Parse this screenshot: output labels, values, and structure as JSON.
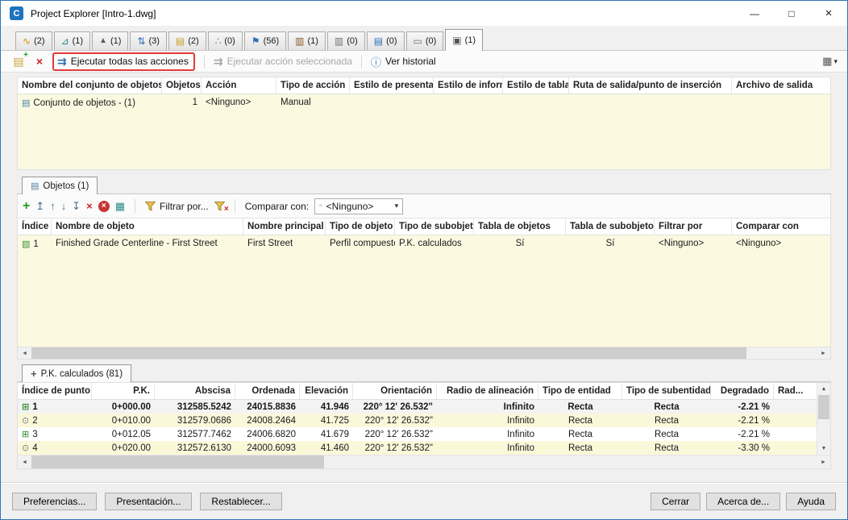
{
  "window": {
    "title": "Project Explorer [Intro-1.dwg]"
  },
  "icons": {
    "app_logo": "C",
    "minimize": "—",
    "maximize": "□",
    "close": "×",
    "tabs": [
      "∿",
      "⊿",
      "▲",
      "⇅",
      "▤",
      "∴",
      "⚑",
      "▥",
      "▥",
      "▤",
      "▭",
      "▣"
    ],
    "new_action_set": "▤",
    "new_action_plus": "+",
    "delete_action_set": "×",
    "run_all": "⇉",
    "run_selected": "⇉",
    "history_info": "ⓘ",
    "columns": "▦",
    "dropdown_arrow": "▾",
    "add": "+",
    "move_top": "↥",
    "move_up": "↑",
    "move_down": "↓",
    "move_bottom": "↧",
    "remove": "×",
    "remove_all": "×",
    "table_style": "▦",
    "clear_filter_x": "×",
    "none_box": "▫",
    "objects_tab_icon": "▤",
    "stations_tab_icon": "+",
    "set_row_icon": "▤",
    "object_row_icon": "▧",
    "station_major": "⊞",
    "station_minor": "⊙",
    "left": "◄",
    "right": "►",
    "up": "▲",
    "down": "▼"
  },
  "tabs": [
    {
      "count": "(2)"
    },
    {
      "count": "(1)"
    },
    {
      "count": "(1)"
    },
    {
      "count": "(3)"
    },
    {
      "count": "(2)"
    },
    {
      "count": "(0)"
    },
    {
      "count": "(56)"
    },
    {
      "count": "(1)"
    },
    {
      "count": "(0)"
    },
    {
      "count": "(0)"
    },
    {
      "count": "(0)"
    },
    {
      "count": "(1)"
    }
  ],
  "toolbar": {
    "execute_all": "Ejecutar todas las acciones",
    "execute_selected": "Ejecutar acción seleccionada",
    "view_history": "Ver historial"
  },
  "sets": {
    "headers": [
      "Nombre del conjunto de objetos",
      "Objetos",
      "Acción",
      "Tipo de acción",
      "Estilo de presentación",
      "Estilo de informe",
      "Estilo de tabla",
      "Ruta de salida/punto de inserción",
      "Archivo de salida"
    ],
    "row": [
      "Conjunto de objetos - (1)",
      "1",
      "<Ninguno>",
      "Manual"
    ]
  },
  "objects": {
    "tab": "Objetos (1)",
    "filter_button": "Filtrar por...",
    "compare_label": "Comparar con:",
    "compare_value": "<Ninguno>",
    "headers": [
      "Índice",
      "Nombre de objeto",
      "Nombre principal",
      "Tipo de objeto",
      "Tipo de subobjeto",
      "Tabla de objetos",
      "Tabla de subobjetos",
      "Filtrar por",
      "Comparar con"
    ],
    "row": [
      "1",
      "Finished Grade Centerline - First Street",
      "First Street",
      "Perfil compuesto",
      "P.K. calculados",
      "Sí",
      "Sí",
      "<Ninguno>",
      "<Ninguno>"
    ]
  },
  "stations": {
    "tab": "P.K. calculados (81)",
    "headers": [
      "Índice de punto",
      "P.K.",
      "Abscisa",
      "Ordenada",
      "Elevación",
      "Orientación",
      "Radio de alineación",
      "Tipo de entidad",
      "Tipo de subentidad",
      "Degradado",
      "Rad..."
    ],
    "rows": [
      [
        "1",
        "0+000.00",
        "312585.5242",
        "24015.8836",
        "41.946",
        "220° 12' 26.532\"",
        "Infinito",
        "Recta",
        "Recta",
        "-2.21 %"
      ],
      [
        "2",
        "0+010.00",
        "312579.0686",
        "24008.2464",
        "41.725",
        "220° 12' 26.532\"",
        "Infinito",
        "Recta",
        "Recta",
        "-2.21 %"
      ],
      [
        "3",
        "0+012.05",
        "312577.7462",
        "24006.6820",
        "41.679",
        "220° 12' 26.532\"",
        "Infinito",
        "Recta",
        "Recta",
        "-2.21 %"
      ],
      [
        "4",
        "0+020.00",
        "312572.6130",
        "24000.6093",
        "41.460",
        "220° 12' 26.532\"",
        "Infinito",
        "Recta",
        "Recta",
        "-3.30 %"
      ]
    ]
  },
  "footer": {
    "left": [
      "Preferencias...",
      "Presentación...",
      "Restablecer..."
    ],
    "right": [
      "Cerrar",
      "Acerca de...",
      "Ayuda"
    ]
  }
}
